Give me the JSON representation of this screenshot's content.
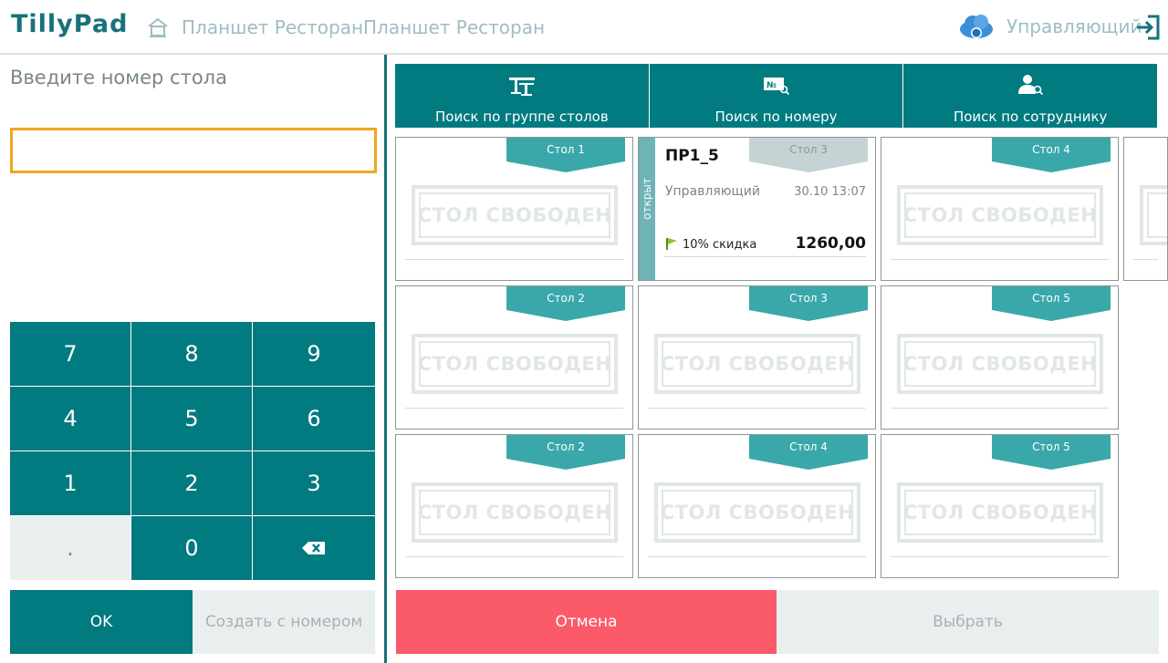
{
  "header": {
    "logo": "TillyPad",
    "breadcrumbs": [
      "Планшет Ресторан",
      "Планшет Ресторан"
    ],
    "user": "Управляющий"
  },
  "left": {
    "prompt": "Введите номер стола",
    "input_value": "",
    "keys": [
      "7",
      "8",
      "9",
      "4",
      "5",
      "6",
      "1",
      "2",
      "3",
      ".",
      "0"
    ],
    "ok_label": "OK",
    "create_label": "Создать с номером"
  },
  "search": {
    "by_group": "Поиск по группе столов",
    "by_number": "Поиск по номеру",
    "by_employee": "Поиск по сотруднику"
  },
  "cards": [
    {
      "label": "Стол 1",
      "status": "СТОЛ СВОБОДЕН"
    },
    {
      "label": "Стол 3",
      "status": "открыт",
      "order": "ПР1_5",
      "waiter": "Управляющий",
      "time": "30.10 13:07",
      "discount": "10% скидка",
      "total": "1260,00"
    },
    {
      "label": "Стол 4",
      "status": "СТОЛ СВОБОДЕН"
    },
    {
      "label": "Стол 2",
      "status": "СТОЛ СВОБОДЕН"
    },
    {
      "label": "Стол 3",
      "status": "СТОЛ СВОБОДЕН"
    },
    {
      "label": "Стол 5",
      "status": "СТОЛ СВОБОДЕН"
    },
    {
      "label": "Стол 2",
      "status": "СТОЛ СВОБОДЕН"
    },
    {
      "label": "Стол 4",
      "status": "СТОЛ СВОБОДЕН"
    },
    {
      "label": "Стол 5",
      "status": "СТОЛ СВОБОДЕН"
    }
  ],
  "bottom": {
    "cancel_label": "Отмена",
    "select_label": "Выбрать"
  },
  "colors": {
    "teal": "#017a80",
    "tag_teal": "#3aa8aa",
    "tag_grey": "#c4d3d3",
    "cancel": "#fb5a69",
    "input_border": "#f0a522"
  }
}
